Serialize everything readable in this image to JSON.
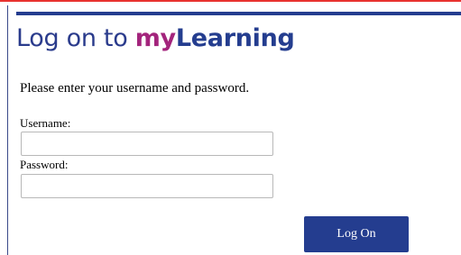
{
  "header": {
    "title_prefix": "Log on to ",
    "brand_my": "my",
    "brand_learning": "Learning"
  },
  "form": {
    "instructions": "Please enter your username and password.",
    "username_label": "Username:",
    "username_value": "",
    "password_label": "Password:",
    "password_value": "",
    "submit_label": "Log On"
  },
  "colors": {
    "brand_blue": "#243d8f",
    "brand_magenta": "#a3247c",
    "top_accent_red": "#e8322f"
  }
}
